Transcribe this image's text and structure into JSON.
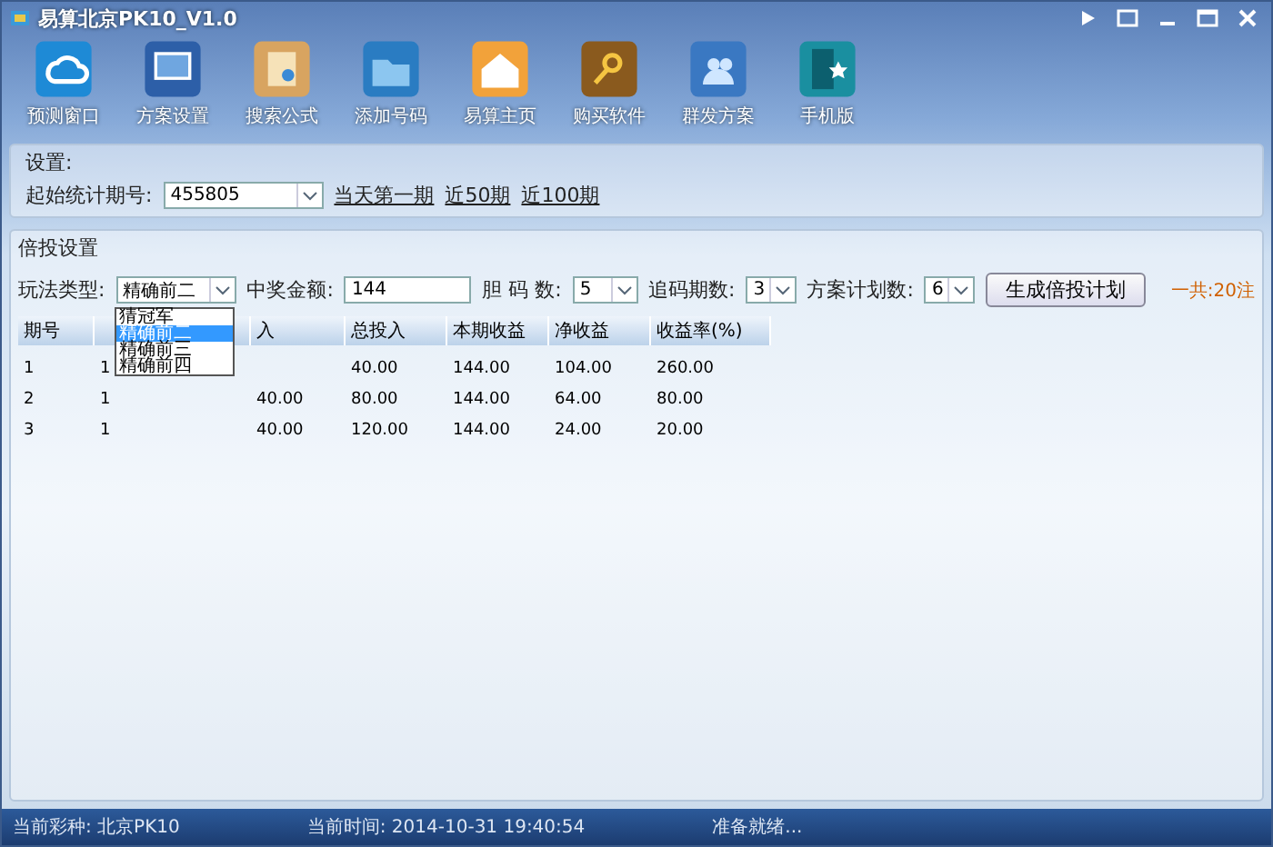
{
  "window": {
    "title": "易算北京PK10_V1.0"
  },
  "toolbar": [
    {
      "label": "预测窗口",
      "kind": "cloud"
    },
    {
      "label": "方案设置",
      "kind": "monitor"
    },
    {
      "label": "搜索公式",
      "kind": "notebook"
    },
    {
      "label": "添加号码",
      "kind": "folder"
    },
    {
      "label": "易算主页",
      "kind": "home"
    },
    {
      "label": "购买软件",
      "kind": "key"
    },
    {
      "label": "群发方案",
      "kind": "people"
    },
    {
      "label": "手机版",
      "kind": "phone"
    }
  ],
  "settings": {
    "title": "设置:",
    "start_label": "起始统计期号:",
    "start_value": "455805",
    "links": [
      "当天第一期",
      "近50期",
      "近100期"
    ]
  },
  "plan": {
    "title": "倍投设置",
    "play_label": "玩法类型:",
    "play_value": "精确前二",
    "play_options": [
      {
        "label": "猜冠军",
        "selected": false
      },
      {
        "label": "精确前二",
        "selected": true
      },
      {
        "label": "精确前三",
        "selected": false
      },
      {
        "label": "精确前四",
        "selected": false
      }
    ],
    "prize_label": "中奖金额:",
    "prize_value": "144",
    "code_label": "胆 码 数:",
    "code_value": "5",
    "chase_label": "追码期数:",
    "chase_value": "3",
    "count_label": "方案计划数:",
    "count_value": "6",
    "generate_button": "生成倍投计划",
    "total": "一共:20注"
  },
  "table": {
    "columns": [
      "期号",
      null,
      "入",
      "总投入",
      "本期收益",
      "净收益",
      "收益率(%)"
    ],
    "rows": [
      [
        "1",
        "1",
        null,
        "40.00",
        "144.00",
        "104.00",
        "260.00"
      ],
      [
        "2",
        "1",
        "40.00",
        "80.00",
        "144.00",
        "64.00",
        "80.00"
      ],
      [
        "3",
        "1",
        "40.00",
        "120.00",
        "144.00",
        "24.00",
        "20.00"
      ]
    ]
  },
  "status_bar": {
    "lottery": "当前彩种: 北京PK10",
    "time": "当前时间: 2014-10-31 19:40:54",
    "state": "准备就绪..."
  }
}
